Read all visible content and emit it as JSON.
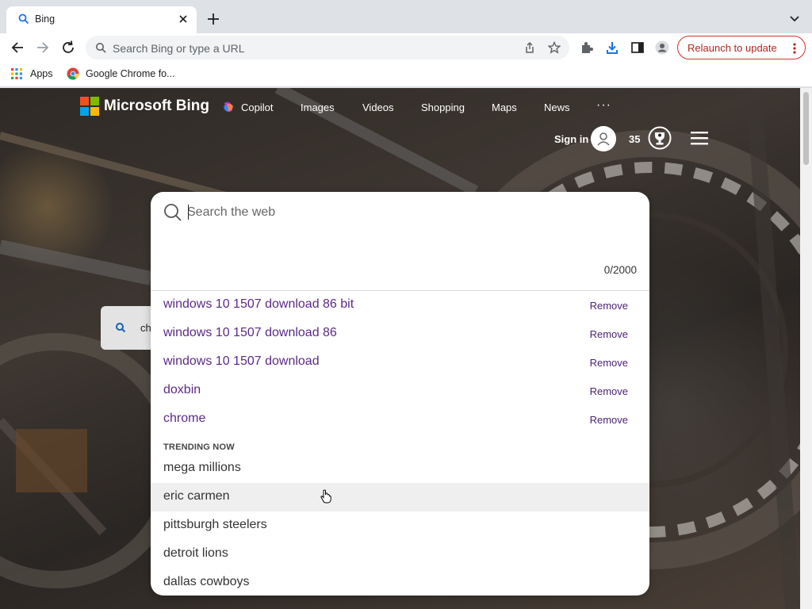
{
  "browser": {
    "tab": {
      "title": "Bing"
    },
    "omnibox": {
      "placeholder": "Search Bing or type a URL"
    },
    "relaunch_label": "Relaunch to update",
    "bookmarks": [
      {
        "label": "Apps",
        "icon": "apps-grid-icon"
      },
      {
        "label": "Google Chrome fo...",
        "icon": "chrome-icon"
      }
    ]
  },
  "bing": {
    "logo_text": "Microsoft Bing",
    "nav": [
      {
        "label": "Copilot"
      },
      {
        "label": "Images"
      },
      {
        "label": "Videos"
      },
      {
        "label": "Shopping"
      },
      {
        "label": "Maps"
      },
      {
        "label": "News"
      }
    ],
    "more_label": "···",
    "sign_in": "Sign in",
    "points": "35",
    "background_chip_text": "ch"
  },
  "search": {
    "placeholder": "Search the web",
    "char_count": "0/2000",
    "history": [
      {
        "text": "windows 10 1507 download 86 bit",
        "action": "Remove"
      },
      {
        "text": "windows 10 1507 download 86",
        "action": "Remove"
      },
      {
        "text": "windows 10 1507 download",
        "action": "Remove"
      },
      {
        "text": "doxbin",
        "action": "Remove"
      },
      {
        "text": "chrome",
        "action": "Remove"
      }
    ],
    "trending_heading": "TRENDING NOW",
    "trending": [
      {
        "text": "mega millions"
      },
      {
        "text": "eric carmen",
        "hovered": true
      },
      {
        "text": "pittsburgh steelers"
      },
      {
        "text": "detroit lions"
      },
      {
        "text": "dallas cowboys"
      }
    ]
  },
  "colors": {
    "history_text": "#5b2a86",
    "relaunch_border": "#d93025",
    "ms_red": "#f25022",
    "ms_green": "#7fba00",
    "ms_blue": "#00a4ef",
    "ms_yellow": "#ffb900"
  }
}
